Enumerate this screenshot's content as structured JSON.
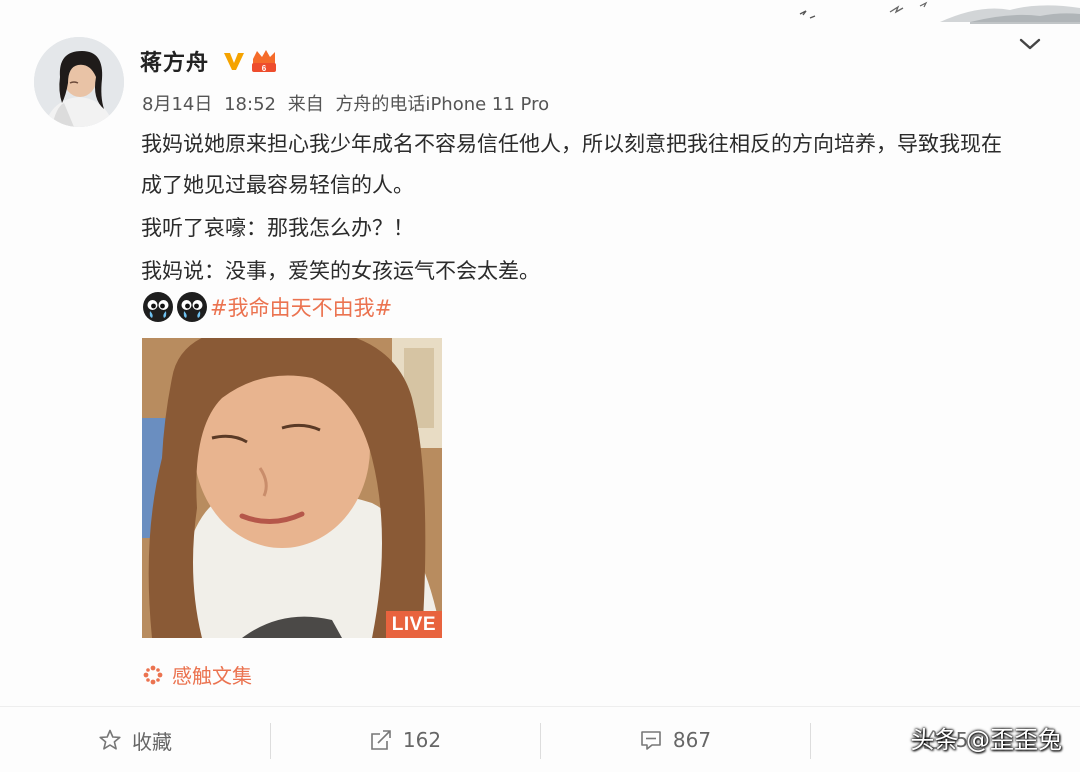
{
  "post": {
    "author": "蒋方舟",
    "date": "8月14日",
    "time": "18:52",
    "source_prefix": "来自",
    "source": "方舟的电话iPhone 11 Pro",
    "paragraphs": [
      "我妈说她原来担心我少年成名不容易信任他人，所以刻意把我往相反的方向培养，导致我现在成了她见过最容易轻信的人。",
      "我听了哀嚎：那我怎么办？！",
      "我妈说：没事，爱笑的女孩运气不会太差。"
    ],
    "topic": "#我命由天不由我#",
    "emojis": [
      "crying-emoji",
      "crying-emoji"
    ],
    "live_label": "LIVE",
    "collection": "感触文集"
  },
  "actions": {
    "favorite_label": "收藏",
    "repost_count": "162",
    "comment_count": "867",
    "like_count": "5"
  },
  "watermark": "头条 @歪歪兔",
  "colors": {
    "accent": "#eb7350",
    "verified": "#f5a300",
    "text": "#2b2b2b",
    "meta": "#555555"
  }
}
